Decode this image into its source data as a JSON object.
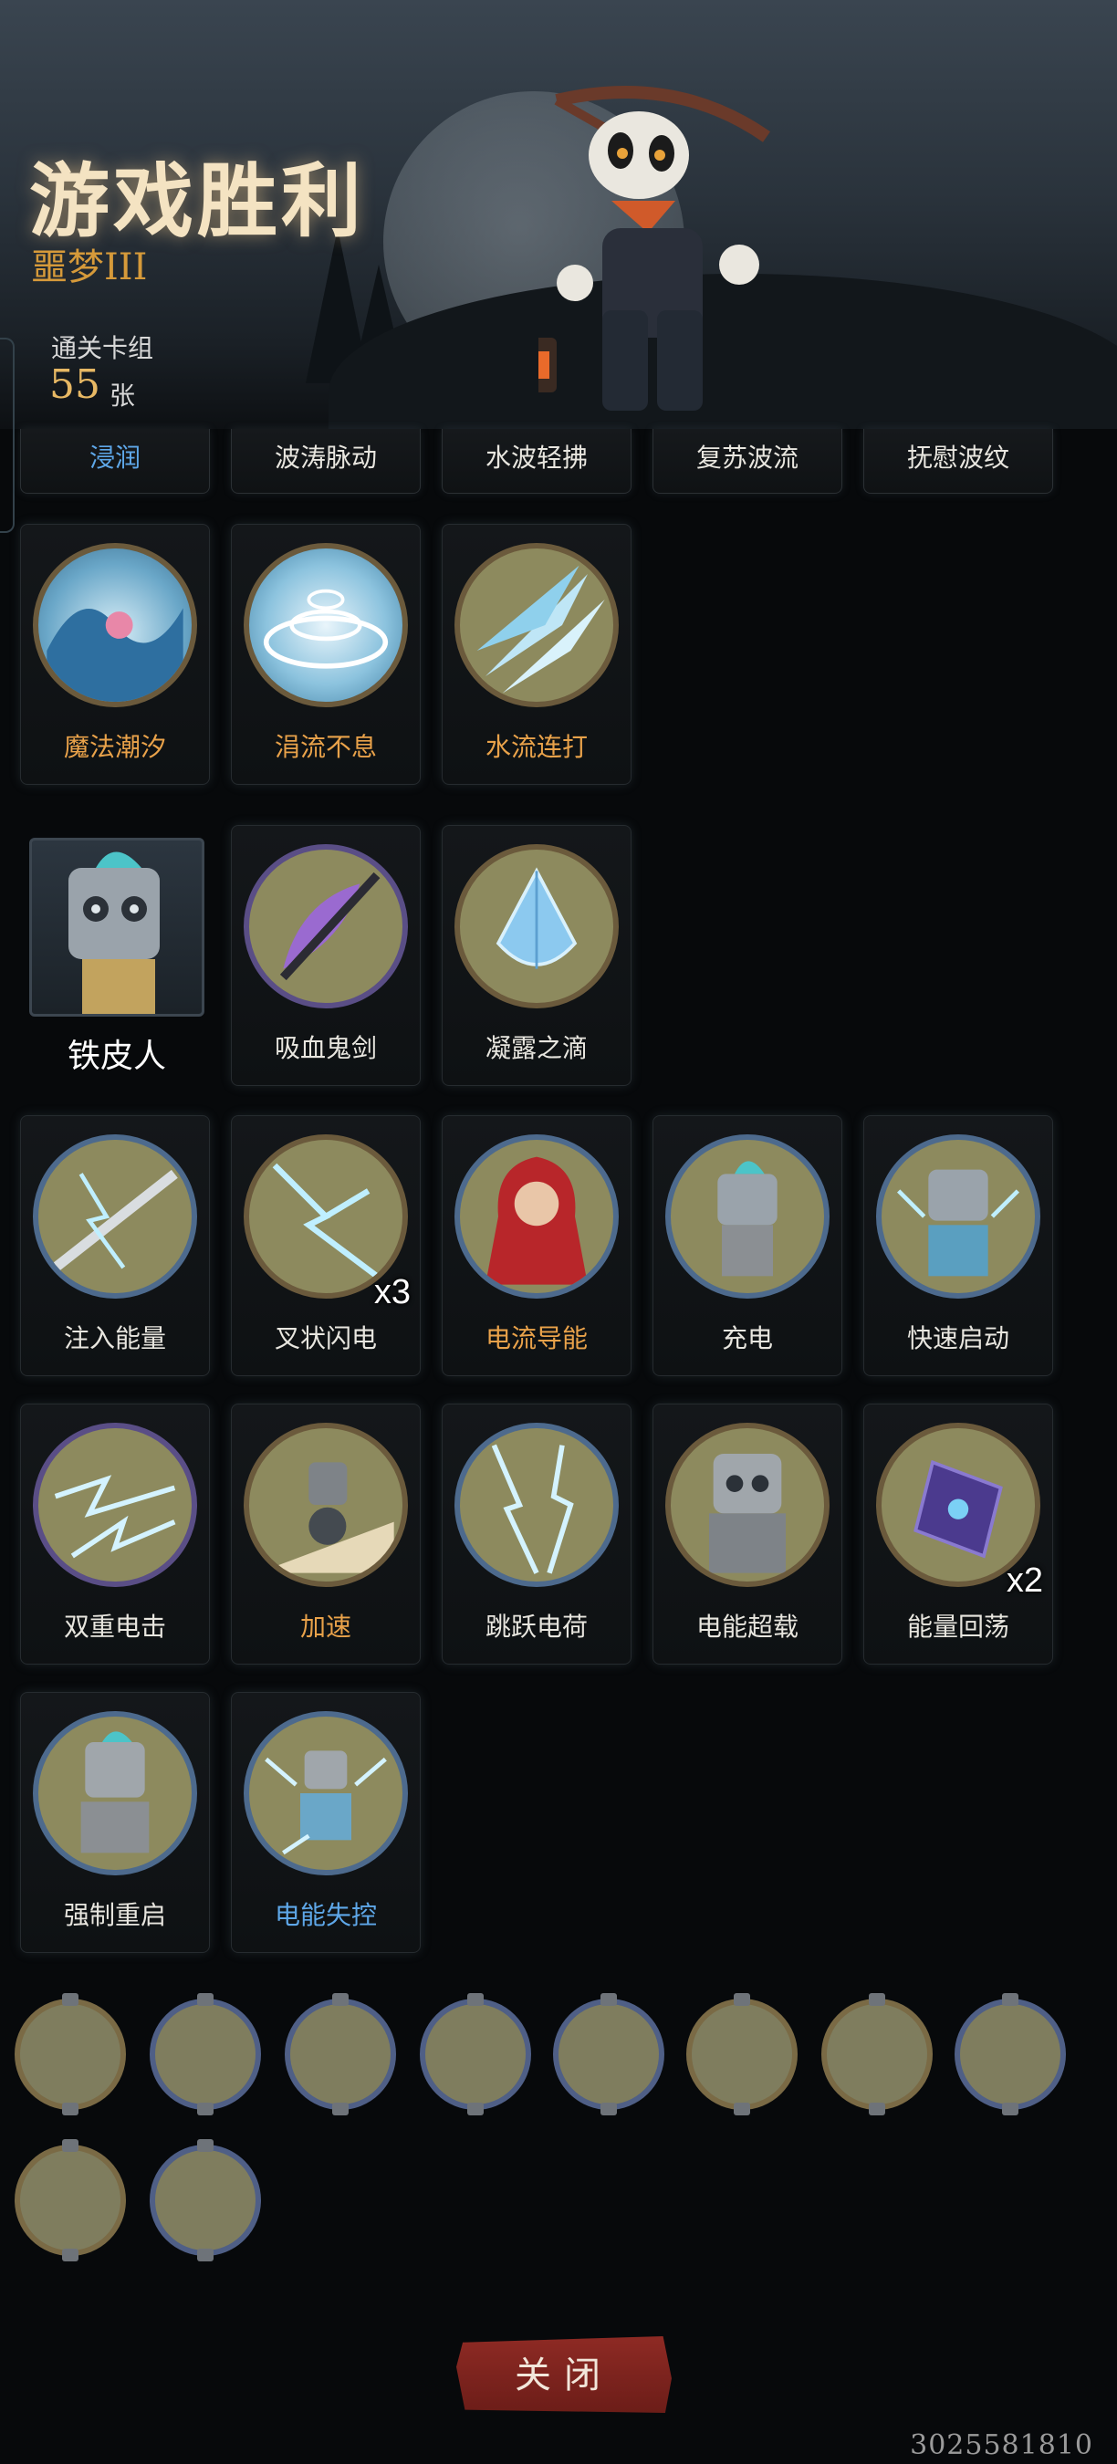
{
  "header": {
    "title": "游戏胜利",
    "difficulty": "噩梦III",
    "deck_label": "通关卡组",
    "deck_count": "55",
    "deck_unit": "张"
  },
  "top_row": [
    {
      "label": "浸润",
      "color": "#5ea7e8"
    },
    {
      "label": "波涛脉动"
    },
    {
      "label": "水波轻拂"
    },
    {
      "label": "复苏波流"
    },
    {
      "label": "抚慰波纹"
    }
  ],
  "water_cards": [
    {
      "label": "魔法潮汐",
      "icon": "wave-mermaid-icon",
      "color": "#e9a24a"
    },
    {
      "label": "涓流不息",
      "icon": "whirlpool-icon",
      "color": "#e9a24a"
    },
    {
      "label": "水流连打",
      "icon": "water-spikes-icon",
      "color": "#e9a24a"
    }
  ],
  "character": {
    "name": "铁皮人",
    "icon": "tin-robot-portrait"
  },
  "relic_cards": [
    {
      "label": "吸血鬼剑",
      "icon": "vampire-sword-icon"
    },
    {
      "label": "凝露之滴",
      "icon": "crystal-drop-icon"
    }
  ],
  "electric_cards": [
    {
      "label": "注入能量",
      "icon": "charged-sword-icon"
    },
    {
      "label": "叉状闪电",
      "icon": "forked-lightning-icon",
      "multiplier": "x3"
    },
    {
      "label": "电流导能",
      "icon": "red-hood-girl-icon",
      "color": "#e9a24a"
    },
    {
      "label": "充电",
      "icon": "robot-charge-icon"
    },
    {
      "label": "快速启动",
      "icon": "robot-quickstart-icon"
    },
    {
      "label": "双重电击",
      "icon": "double-shock-icon"
    },
    {
      "label": "加速",
      "icon": "rushing-robot-icon",
      "color": "#e9a24a"
    },
    {
      "label": "跳跃电荷",
      "icon": "jumping-charge-icon"
    },
    {
      "label": "电能超载",
      "icon": "overload-robot-icon"
    },
    {
      "label": "能量回荡",
      "icon": "energy-card-icon",
      "multiplier": "x2"
    },
    {
      "label": "强制重启",
      "icon": "robot-reboot-icon"
    },
    {
      "label": "电能失控",
      "icon": "robot-runaway-icon",
      "color": "#5ea7e8"
    }
  ],
  "companions": [
    {
      "icon": "deer-companion-icon"
    },
    {
      "icon": "knight-companion-icon"
    },
    {
      "icon": "white-cat-companion-icon"
    },
    {
      "icon": "wolf-companion-icon"
    },
    {
      "icon": "crow-companion-icon"
    },
    {
      "icon": "mermaid-companion-icon"
    },
    {
      "icon": "shadow-beast-companion-icon"
    },
    {
      "icon": "pug-companion-icon"
    },
    {
      "icon": "spark-beast-companion-icon"
    },
    {
      "icon": "raccoon-companion-icon"
    }
  ],
  "footer": {
    "close_label": "关闭",
    "uid": "3025581810"
  }
}
